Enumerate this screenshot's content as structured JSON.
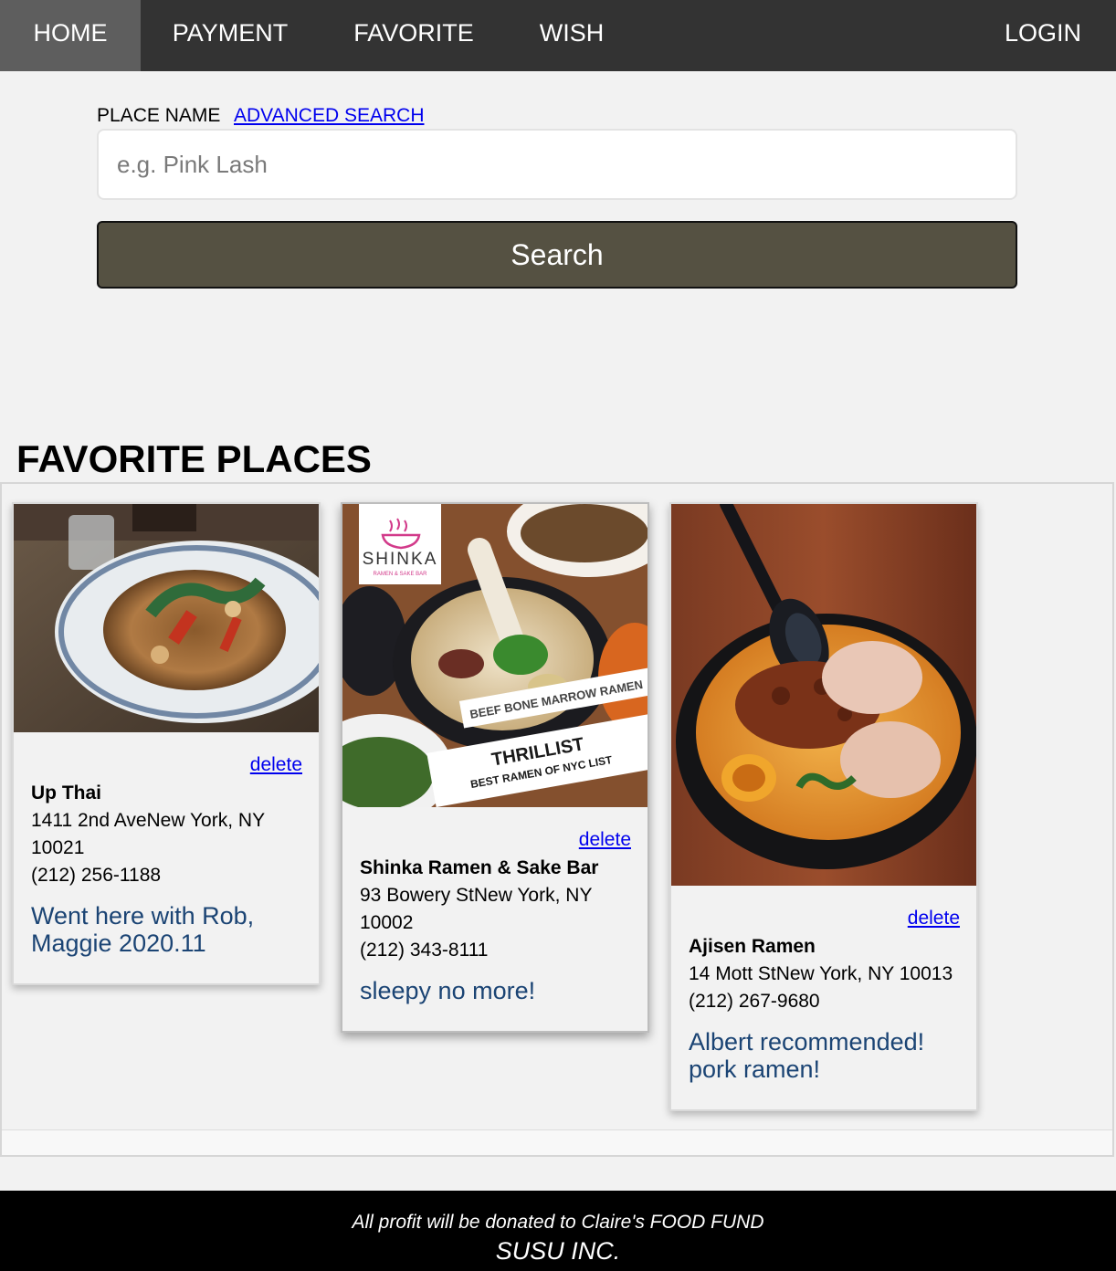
{
  "nav": {
    "home": "HOME",
    "payment": "PAYMENT",
    "favorite": "FAVORITE",
    "wish": "WISH",
    "login": "LOGIN"
  },
  "search": {
    "label": "PLACE NAME",
    "advanced_link": "ADVANCED SEARCH",
    "placeholder": "e.g. Pink Lash",
    "value": "",
    "button": "Search"
  },
  "favorites": {
    "title": "FAVORITE PLACES",
    "delete_label": "delete",
    "cards": [
      {
        "name": "Up Thai",
        "address": "1411 2nd AveNew York, NY 10021",
        "phone": "(212) 256-1188",
        "note": "Went here with Rob, Maggie 2020.11"
      },
      {
        "name": "Shinka Ramen & Sake Bar",
        "address": "93 Bowery StNew York, NY 10002",
        "phone": "(212) 343-8111",
        "note": "sleepy no more!",
        "photo_text": {
          "logo": "SHINKA",
          "logo_sub": "RAMEN & SAKE BAR",
          "banner1": "BEEF BONE MARROW RAMEN",
          "banner2": "THRILLIST",
          "banner3": "BEST RAMEN OF NYC LIST"
        }
      },
      {
        "name": "Ajisen Ramen",
        "address": "14 Mott StNew York, NY 10013",
        "phone": "(212) 267-9680",
        "note": "Albert recommended! pork ramen!"
      }
    ]
  },
  "footer": {
    "line1": "All profit will be donated to Claire's FOOD FUND",
    "line2": "SUSU INC."
  },
  "colors": {
    "nav_bg": "#333333",
    "nav_active": "#5e5e5e",
    "search_button": "#555142",
    "note_text": "#1b4474",
    "link": "#0000ee"
  }
}
